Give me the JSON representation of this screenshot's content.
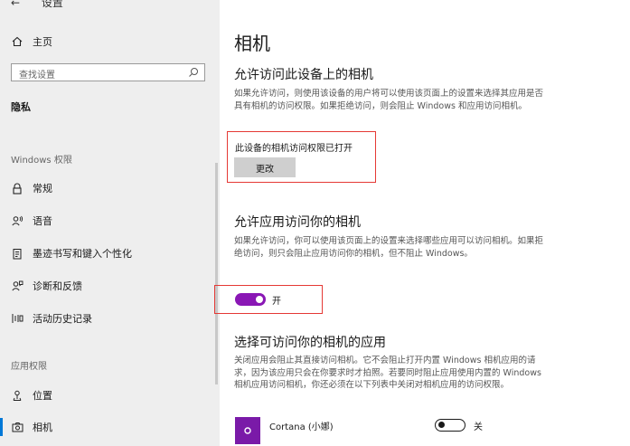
{
  "sidebar": {
    "back_label": "设置",
    "home_label": "主页",
    "search_placeholder": "查找设置",
    "section_title": "隐私",
    "groups": [
      {
        "label": "Windows 权限"
      },
      {
        "label": "应用权限"
      }
    ],
    "items": [
      {
        "label": "常规",
        "icon": "lock-icon"
      },
      {
        "label": "语音",
        "icon": "voice-icon"
      },
      {
        "label": "墨迹书写和键入个性化",
        "icon": "pen-clipboard-icon"
      },
      {
        "label": "诊断和反馈",
        "icon": "feedback-icon"
      },
      {
        "label": "活动历史记录",
        "icon": "activity-history-icon"
      },
      {
        "label": "位置",
        "icon": "location-icon"
      },
      {
        "label": "相机",
        "icon": "camera-icon"
      }
    ]
  },
  "main": {
    "title": "相机",
    "device_section": {
      "heading": "允许访问此设备上的相机",
      "description": "如果允许访问，则使用该设备的用户将可以使用该页面上的设置来选择其应用是否具有相机的访问权限。如果拒绝访问，则会阻止 Windows 和应用访问相机。",
      "status": "此设备的相机访问权限已打开",
      "change_button": "更改"
    },
    "apps_section": {
      "heading": "允许应用访问你的相机",
      "description": "如果允许访问，你可以使用该页面上的设置来选择哪些应用可以访问相机。如果拒绝访问，则只会阻止应用访问你的相机，但不阻止 Windows。",
      "toggle_label": "开",
      "toggle_state": "on"
    },
    "choose_section": {
      "heading": "选择可访问你的相机的应用",
      "description": "关闭应用会阻止其直接访问相机。它不会阻止打开内置 Windows 相机应用的请求，因为该应用只会在你要求时才拍照。若要同时阻止应用使用内置的 Windows 相机应用访问相机，你还必须在以下列表中关闭对相机应用的访问权限。",
      "apps": [
        {
          "name": "Cortana (小娜)",
          "toggle_label": "关",
          "toggle_state": "off"
        }
      ]
    }
  },
  "colors": {
    "accent": "#8a17b5",
    "highlight_box": "#e53935",
    "sidebar_bg": "#eeeeee"
  }
}
